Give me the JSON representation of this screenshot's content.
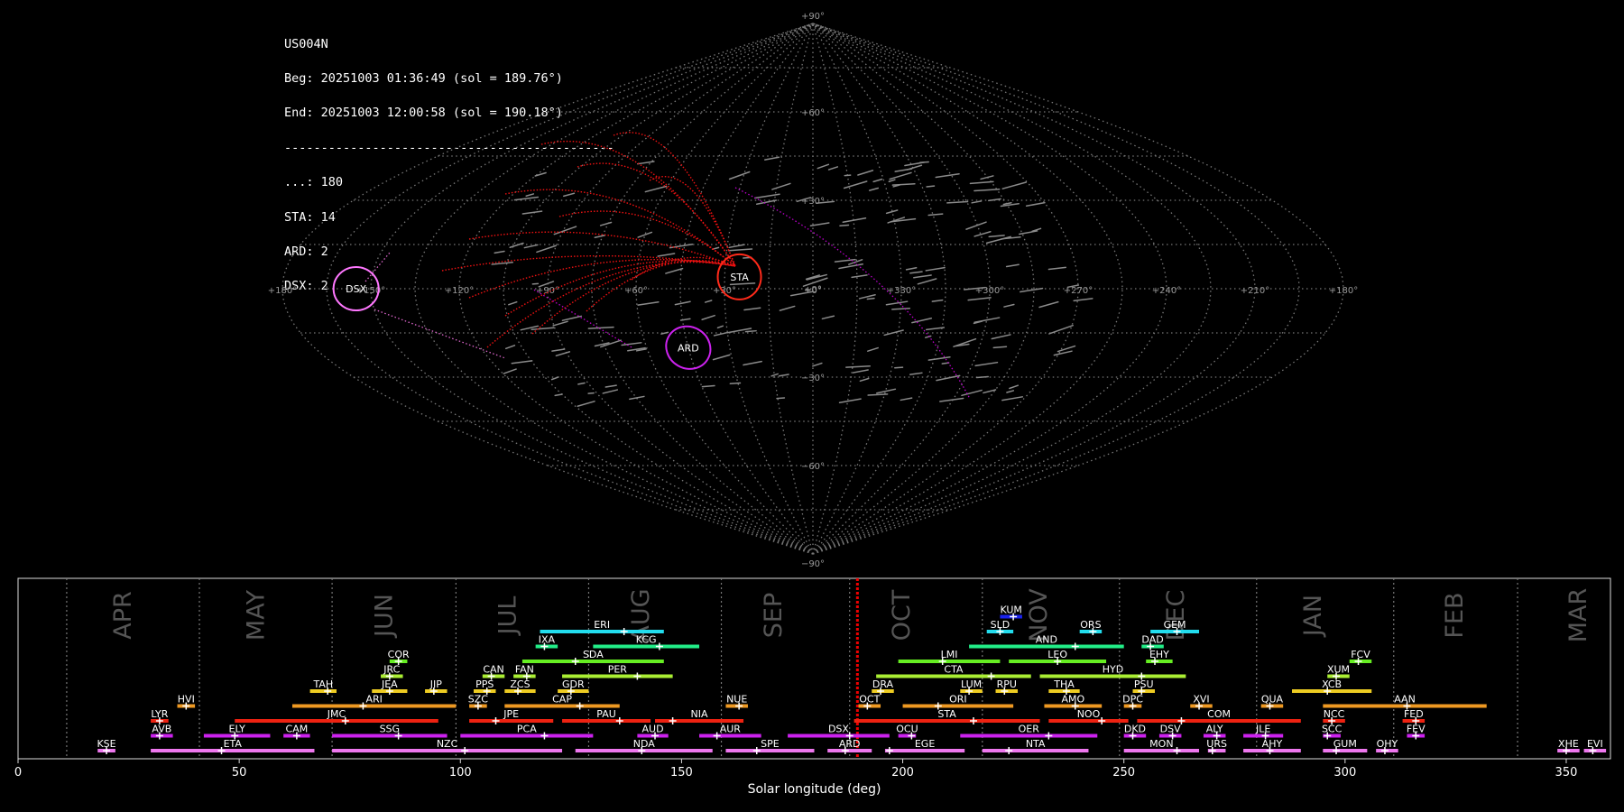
{
  "info": {
    "station": "US004N",
    "begin": "Beg: 20251003 01:36:49 (sol = 189.76°)",
    "end": "End: 20251003 12:00:58 (sol = 190.18°)",
    "separator": "---------------------------------------------",
    "counts": [
      "...: 180",
      "STA: 14",
      "ARD: 2",
      "DSX: 2"
    ]
  },
  "sky_map": {
    "lat_labels": [
      {
        "lat": 90,
        "text": "+90°"
      },
      {
        "lat": 60,
        "text": "+60°"
      },
      {
        "lat": 30,
        "text": "+30°"
      },
      {
        "lat": 0,
        "text": "+0°"
      },
      {
        "lat": -30,
        "text": "−30°"
      },
      {
        "lat": -60,
        "text": "−60°"
      },
      {
        "lat": -90,
        "text": "−90°"
      }
    ],
    "lon_labels": [
      {
        "x": 180,
        "text": "+180°"
      },
      {
        "x": 150,
        "text": "+150°"
      },
      {
        "x": 120,
        "text": "+120°"
      },
      {
        "x": 90,
        "text": "+90°"
      },
      {
        "x": 60,
        "text": "+60°"
      },
      {
        "x": 30,
        "text": "+30°"
      },
      {
        "x": 0,
        "text": "+0°"
      },
      {
        "x": -30,
        "text": "+330°"
      },
      {
        "x": -60,
        "text": "+300°"
      },
      {
        "x": -90,
        "text": "+270°"
      },
      {
        "x": -120,
        "text": "+240°"
      },
      {
        "x": -150,
        "text": "+210°"
      },
      {
        "x": -180,
        "text": "+180°"
      }
    ],
    "radiants": [
      {
        "name": "STA",
        "x": 25,
        "y": 4,
        "color": "#ff2a1a"
      },
      {
        "name": "DSX",
        "x": 155,
        "y": 0,
        "color": "#ff77ff"
      },
      {
        "name": "ARD",
        "x": 45,
        "y": -20,
        "color": "#cc22ee"
      }
    ]
  },
  "chart_data": {
    "type": "timeline",
    "xlabel": "Solar longitude (deg)",
    "xlim": [
      0,
      360
    ],
    "xticks": [
      0,
      50,
      100,
      150,
      200,
      250,
      300,
      350
    ],
    "current_sol": 189.76,
    "months": [
      {
        "label": "APR",
        "x": 24
      },
      {
        "label": "MAY",
        "x": 54
      },
      {
        "label": "JUN",
        "x": 83
      },
      {
        "label": "JUL",
        "x": 111
      },
      {
        "label": "AUG",
        "x": 141
      },
      {
        "label": "SEP",
        "x": 171
      },
      {
        "label": "OCT",
        "x": 200
      },
      {
        "label": "NOV",
        "x": 231
      },
      {
        "label": "DEC",
        "x": 262
      },
      {
        "label": "JAN",
        "x": 293
      },
      {
        "label": "FEB",
        "x": 325
      },
      {
        "label": "MAR",
        "x": 353
      }
    ],
    "month_lines": [
      11,
      41,
      71,
      99,
      129,
      159,
      188,
      218,
      249,
      280,
      311,
      339
    ],
    "showers": [
      {
        "code": "KUM",
        "start": 222,
        "end": 227,
        "peak": 225,
        "row": 10,
        "color": "#1a22ee"
      },
      {
        "code": "ERI",
        "start": 118,
        "end": 146,
        "peak": 137,
        "row": 9,
        "color": "#22ddee"
      },
      {
        "code": "SLD",
        "start": 219,
        "end": 225,
        "peak": 222,
        "row": 9,
        "color": "#22ddee"
      },
      {
        "code": "ORS",
        "start": 240,
        "end": 245,
        "peak": 243,
        "row": 9,
        "color": "#22ddee"
      },
      {
        "code": "GEM",
        "start": 256,
        "end": 267,
        "peak": 262,
        "row": 9,
        "color": "#22ddee"
      },
      {
        "code": "IXA",
        "start": 117,
        "end": 122,
        "peak": 119,
        "row": 8,
        "color": "#22ee88"
      },
      {
        "code": "KCG",
        "start": 130,
        "end": 154,
        "peak": 145,
        "row": 8,
        "color": "#22ee88"
      },
      {
        "code": "AND",
        "start": 215,
        "end": 250,
        "peak": 239,
        "row": 8,
        "color": "#22ee88"
      },
      {
        "code": "DAD",
        "start": 254,
        "end": 259,
        "peak": 256,
        "row": 8,
        "color": "#22ee88"
      },
      {
        "code": "COR",
        "start": 84,
        "end": 88,
        "peak": 86,
        "row": 7,
        "color": "#66ee22"
      },
      {
        "code": "SDA",
        "start": 114,
        "end": 146,
        "peak": 126,
        "row": 7,
        "color": "#66ee22"
      },
      {
        "code": "LMI",
        "start": 199,
        "end": 222,
        "peak": 209,
        "row": 7,
        "color": "#66ee22"
      },
      {
        "code": "LEO",
        "start": 224,
        "end": 246,
        "peak": 235,
        "row": 7,
        "color": "#66ee22"
      },
      {
        "code": "EHY",
        "start": 255,
        "end": 261,
        "peak": 257,
        "row": 7,
        "color": "#66ee22"
      },
      {
        "code": "FCV",
        "start": 301,
        "end": 306,
        "peak": 303,
        "row": 7,
        "color": "#66ee22"
      },
      {
        "code": "JRC",
        "start": 82,
        "end": 87,
        "peak": 84,
        "row": 6,
        "color": "#aaee33"
      },
      {
        "code": "CAN",
        "start": 105,
        "end": 110,
        "peak": 107,
        "row": 6,
        "color": "#aaee33"
      },
      {
        "code": "FAN",
        "start": 112,
        "end": 117,
        "peak": 115,
        "row": 6,
        "color": "#aaee33"
      },
      {
        "code": "PER",
        "start": 123,
        "end": 148,
        "peak": 140,
        "row": 6,
        "color": "#aaee33"
      },
      {
        "code": "CTA",
        "start": 194,
        "end": 229,
        "peak": 220,
        "row": 6,
        "color": "#aaee33"
      },
      {
        "code": "HYD",
        "start": 231,
        "end": 264,
        "peak": 254,
        "row": 6,
        "color": "#aaee33"
      },
      {
        "code": "XUM",
        "start": 296,
        "end": 301,
        "peak": 298,
        "row": 6,
        "color": "#aaee33"
      },
      {
        "code": "TAH",
        "start": 66,
        "end": 72,
        "peak": 70,
        "row": 5,
        "color": "#eecc22"
      },
      {
        "code": "JEA",
        "start": 80,
        "end": 88,
        "peak": 84,
        "row": 5,
        "color": "#eecc22"
      },
      {
        "code": "JIP",
        "start": 92,
        "end": 97,
        "peak": 94,
        "row": 5,
        "color": "#eecc22"
      },
      {
        "code": "PPS",
        "start": 103,
        "end": 108,
        "peak": 106,
        "row": 5,
        "color": "#eecc22"
      },
      {
        "code": "ZCS",
        "start": 110,
        "end": 117,
        "peak": 113,
        "row": 5,
        "color": "#eecc22"
      },
      {
        "code": "GDR",
        "start": 122,
        "end": 129,
        "peak": 125,
        "row": 5,
        "color": "#eecc22"
      },
      {
        "code": "DRA",
        "start": 193,
        "end": 198,
        "peak": 195,
        "row": 5,
        "color": "#eecc22"
      },
      {
        "code": "LUM",
        "start": 213,
        "end": 218,
        "peak": 215,
        "row": 5,
        "color": "#eecc22"
      },
      {
        "code": "RPU",
        "start": 221,
        "end": 226,
        "peak": 223,
        "row": 5,
        "color": "#eecc22"
      },
      {
        "code": "THA",
        "start": 233,
        "end": 240,
        "peak": 237,
        "row": 5,
        "color": "#eecc22"
      },
      {
        "code": "PSU",
        "start": 252,
        "end": 257,
        "peak": 254,
        "row": 5,
        "color": "#eecc22"
      },
      {
        "code": "XCB",
        "start": 288,
        "end": 306,
        "peak": 296,
        "row": 5,
        "color": "#eecc22"
      },
      {
        "code": "HVI",
        "start": 36,
        "end": 40,
        "peak": 38,
        "row": 4,
        "color": "#ee9922"
      },
      {
        "code": "ARI",
        "start": 62,
        "end": 99,
        "peak": 78,
        "row": 4,
        "color": "#ee9922"
      },
      {
        "code": "SZC",
        "start": 102,
        "end": 106,
        "peak": 104,
        "row": 4,
        "color": "#ee9922"
      },
      {
        "code": "CAP",
        "start": 110,
        "end": 136,
        "peak": 127,
        "row": 4,
        "color": "#ee9922"
      },
      {
        "code": "NUE",
        "start": 160,
        "end": 165,
        "peak": 163,
        "row": 4,
        "color": "#ee9922"
      },
      {
        "code": "OCT",
        "start": 190,
        "end": 195,
        "peak": 192,
        "row": 4,
        "color": "#ee9922"
      },
      {
        "code": "ORI",
        "start": 200,
        "end": 225,
        "peak": 208,
        "row": 4,
        "color": "#ee9922"
      },
      {
        "code": "AMO",
        "start": 232,
        "end": 245,
        "peak": 239,
        "row": 4,
        "color": "#ee9922"
      },
      {
        "code": "DPC",
        "start": 250,
        "end": 254,
        "peak": 252,
        "row": 4,
        "color": "#ee9922"
      },
      {
        "code": "XVI",
        "start": 265,
        "end": 270,
        "peak": 267,
        "row": 4,
        "color": "#ee9922"
      },
      {
        "code": "QUA",
        "start": 281,
        "end": 286,
        "peak": 283,
        "row": 4,
        "color": "#ee9922"
      },
      {
        "code": "AAN",
        "start": 295,
        "end": 332,
        "peak": 314,
        "row": 4,
        "color": "#ee9922"
      },
      {
        "code": "LYR",
        "start": 30,
        "end": 34,
        "peak": 32,
        "row": 3,
        "color": "#ee2211"
      },
      {
        "code": "JMC",
        "start": 49,
        "end": 95,
        "peak": 74,
        "row": 3,
        "color": "#ee2211"
      },
      {
        "code": "JPE",
        "start": 102,
        "end": 121,
        "peak": 108,
        "row": 3,
        "color": "#ee2211"
      },
      {
        "code": "PAU",
        "start": 123,
        "end": 143,
        "peak": 136,
        "row": 3,
        "color": "#ee2211"
      },
      {
        "code": "NIA",
        "start": 144,
        "end": 164,
        "peak": 148,
        "row": 3,
        "color": "#ee2211"
      },
      {
        "code": "STA",
        "start": 189,
        "end": 231,
        "peak": 216,
        "row": 3,
        "color": "#ee2211"
      },
      {
        "code": "NOO",
        "start": 233,
        "end": 251,
        "peak": 245,
        "row": 3,
        "color": "#ee2211"
      },
      {
        "code": "COM",
        "start": 253,
        "end": 290,
        "peak": 263,
        "row": 3,
        "color": "#ee2211"
      },
      {
        "code": "NCC",
        "start": 295,
        "end": 300,
        "peak": 297,
        "row": 3,
        "color": "#ee2211"
      },
      {
        "code": "FED",
        "start": 313,
        "end": 318,
        "peak": 316,
        "row": 3,
        "color": "#ee2211"
      },
      {
        "code": "AVB",
        "start": 30,
        "end": 35,
        "peak": 32,
        "row": 2,
        "color": "#cc22ee"
      },
      {
        "code": "ELY",
        "start": 42,
        "end": 57,
        "peak": 49,
        "row": 2,
        "color": "#cc22ee"
      },
      {
        "code": "CAM",
        "start": 60,
        "end": 66,
        "peak": 63,
        "row": 2,
        "color": "#cc22ee"
      },
      {
        "code": "SSG",
        "start": 71,
        "end": 97,
        "peak": 86,
        "row": 2,
        "color": "#cc22ee"
      },
      {
        "code": "PCA",
        "start": 100,
        "end": 130,
        "peak": 119,
        "row": 2,
        "color": "#cc22ee"
      },
      {
        "code": "AUD",
        "start": 140,
        "end": 147,
        "peak": 144,
        "row": 2,
        "color": "#cc22ee"
      },
      {
        "code": "AUR",
        "start": 154,
        "end": 168,
        "peak": 158,
        "row": 2,
        "color": "#cc22ee"
      },
      {
        "code": "DSX",
        "start": 174,
        "end": 197,
        "peak": 188,
        "row": 2,
        "color": "#cc22ee"
      },
      {
        "code": "OCU",
        "start": 199,
        "end": 203,
        "peak": 202,
        "row": 2,
        "color": "#cc22ee"
      },
      {
        "code": "OER",
        "start": 213,
        "end": 244,
        "peak": 233,
        "row": 2,
        "color": "#cc22ee"
      },
      {
        "code": "DKD",
        "start": 250,
        "end": 255,
        "peak": 252,
        "row": 2,
        "color": "#cc22ee"
      },
      {
        "code": "DSV",
        "start": 258,
        "end": 263,
        "peak": 261,
        "row": 2,
        "color": "#cc22ee"
      },
      {
        "code": "ALY",
        "start": 268,
        "end": 273,
        "peak": 271,
        "row": 2,
        "color": "#cc22ee"
      },
      {
        "code": "JLE",
        "start": 277,
        "end": 286,
        "peak": 282,
        "row": 2,
        "color": "#cc22ee"
      },
      {
        "code": "SCC",
        "start": 295,
        "end": 299,
        "peak": 296,
        "row": 2,
        "color": "#cc22ee"
      },
      {
        "code": "FEV",
        "start": 314,
        "end": 318,
        "peak": 316,
        "row": 2,
        "color": "#cc22ee"
      },
      {
        "code": "KSE",
        "start": 18,
        "end": 22,
        "peak": 20,
        "row": 1,
        "color": "#ee77ee"
      },
      {
        "code": "ETA",
        "start": 30,
        "end": 67,
        "peak": 46,
        "row": 1,
        "color": "#ee77ee"
      },
      {
        "code": "NZC",
        "start": 71,
        "end": 123,
        "peak": 101,
        "row": 1,
        "color": "#ee77ee"
      },
      {
        "code": "NDA",
        "start": 126,
        "end": 157,
        "peak": 141,
        "row": 1,
        "color": "#ee77ee"
      },
      {
        "code": "SPE",
        "start": 160,
        "end": 180,
        "peak": 167,
        "row": 1,
        "color": "#ee77ee"
      },
      {
        "code": "ARD",
        "start": 183,
        "end": 193,
        "peak": 187,
        "row": 1,
        "color": "#ee77ee"
      },
      {
        "code": "EGE",
        "start": 196,
        "end": 214,
        "peak": 197,
        "row": 1,
        "color": "#ee77ee"
      },
      {
        "code": "NTA",
        "start": 218,
        "end": 242,
        "peak": 224,
        "row": 1,
        "color": "#ee77ee"
      },
      {
        "code": "MON",
        "start": 250,
        "end": 267,
        "peak": 262,
        "row": 1,
        "color": "#ee77ee"
      },
      {
        "code": "URS",
        "start": 269,
        "end": 273,
        "peak": 270,
        "row": 1,
        "color": "#ee77ee"
      },
      {
        "code": "AHY",
        "start": 277,
        "end": 290,
        "peak": 283,
        "row": 1,
        "color": "#ee77ee"
      },
      {
        "code": "GUM",
        "start": 295,
        "end": 305,
        "peak": 298,
        "row": 1,
        "color": "#ee77ee"
      },
      {
        "code": "OHY",
        "start": 307,
        "end": 312,
        "peak": 309,
        "row": 1,
        "color": "#ee77ee"
      },
      {
        "code": "XHE",
        "start": 348,
        "end": 353,
        "peak": 350,
        "row": 1,
        "color": "#ee77ee"
      },
      {
        "code": "EVI",
        "start": 354,
        "end": 359,
        "peak": 356,
        "row": 1,
        "color": "#ee77ee"
      }
    ]
  }
}
